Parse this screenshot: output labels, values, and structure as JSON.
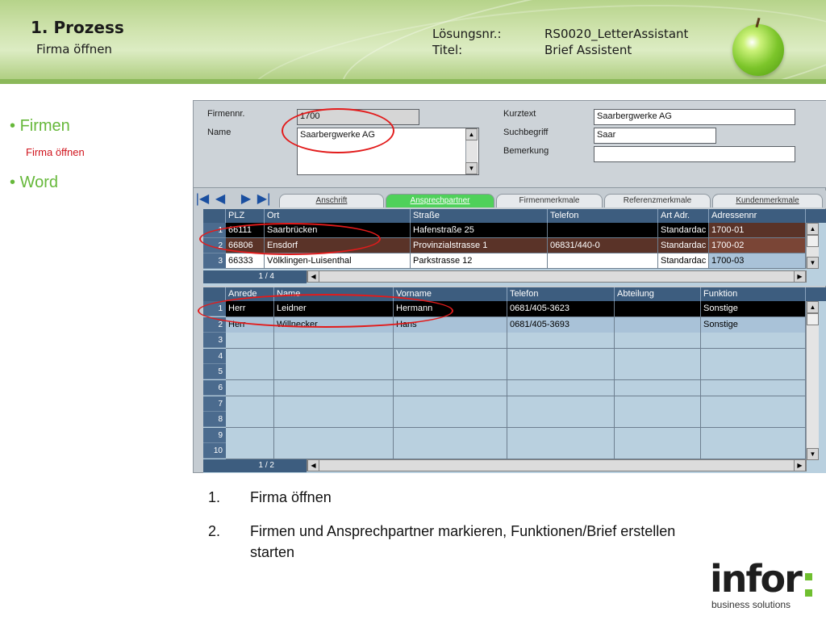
{
  "header": {
    "title": "1. Prozess",
    "subtitle": "Firma öffnen",
    "loesungsnr_label": "Lösungsnr.:",
    "loesungsnr_value": "RS0020_LetterAssistant",
    "titel_label": "Titel:",
    "titel_value": "Brief Assistent"
  },
  "nav": {
    "items": [
      {
        "label": "Firmen",
        "sub": "Firma öffnen"
      },
      {
        "label": "Word"
      }
    ]
  },
  "form": {
    "firmennr_label": "Firmennr.",
    "firmennr_value": "1700",
    "name_label": "Name",
    "name_value": "Saarbergwerke AG",
    "kurztext_label": "Kurztext",
    "kurztext_value": "Saarbergwerke AG",
    "suchbegriff_label": "Suchbegriff",
    "suchbegriff_value": "Saar",
    "bemerkung_label": "Bemerkung",
    "bemerkung_value": ""
  },
  "tabs": [
    {
      "label": "Anschrift",
      "active": false
    },
    {
      "label": "Ansprechpartner",
      "active": true
    },
    {
      "label": "Firmenmerkmale",
      "active": false
    },
    {
      "label": "Referenzmerkmale",
      "active": false
    },
    {
      "label": "Kundenmerkmale",
      "active": false
    }
  ],
  "address_grid": {
    "headers": [
      "PLZ",
      "Ort",
      "Straße",
      "Telefon",
      "Art Adr.",
      "Adressennr"
    ],
    "rows": [
      {
        "num": "1",
        "cells": [
          "66111",
          "Saarbrücken",
          "Hafenstraße 25",
          "",
          "Standardac",
          "1700-01"
        ]
      },
      {
        "num": "2",
        "cells": [
          "66806",
          "Ensdorf",
          "Provinzialstrasse 1",
          "06831/440-0",
          "Standardac",
          "1700-02"
        ]
      },
      {
        "num": "3",
        "cells": [
          "66333",
          "Völklingen-Luisenthal",
          "Parkstrasse 12",
          "",
          "Standardac",
          "1700-03"
        ]
      }
    ],
    "pager": "1 / 4"
  },
  "contact_grid": {
    "headers": [
      "Anrede",
      "Name",
      "Vorname",
      "Telefon",
      "Abteilung",
      "Funktion"
    ],
    "rows": [
      {
        "num": "1",
        "cells": [
          "Herr",
          "Leidner",
          "Hermann",
          "0681/405-3623",
          "",
          "Sonstige"
        ]
      },
      {
        "num": "2",
        "cells": [
          "Herr",
          "Willnecker",
          "Hans",
          "0681/405-3693",
          "",
          "Sonstige"
        ]
      },
      {
        "num": "3",
        "cells": [
          "",
          "",
          "",
          "",
          "",
          ""
        ]
      },
      {
        "num": "4",
        "cells": [
          "",
          "",
          "",
          "",
          "",
          ""
        ]
      },
      {
        "num": "5",
        "cells": [
          "",
          "",
          "",
          "",
          "",
          ""
        ]
      },
      {
        "num": "6",
        "cells": [
          "",
          "",
          "",
          "",
          "",
          ""
        ]
      },
      {
        "num": "7",
        "cells": [
          "",
          "",
          "",
          "",
          "",
          ""
        ]
      },
      {
        "num": "8",
        "cells": [
          "",
          "",
          "",
          "",
          "",
          ""
        ]
      },
      {
        "num": "9",
        "cells": [
          "",
          "",
          "",
          "",
          "",
          ""
        ]
      },
      {
        "num": "10",
        "cells": [
          "",
          "",
          "",
          "",
          "",
          ""
        ]
      }
    ],
    "pager": "1 / 2"
  },
  "steps": [
    {
      "num": "1.",
      "text": "Firma öffnen"
    },
    {
      "num": "2.",
      "text": "Firmen und Ansprechpartner markieren, Funktionen/Brief erstellen",
      "text2": "starten"
    }
  ],
  "logo": {
    "word": "infor",
    "tagline": "business solutions"
  },
  "colors": {
    "accent_green": "#66b83a",
    "nav_sub_red": "#d0141d",
    "grid_header": "#3d5d7f",
    "annotation_red": "#e21b1b"
  }
}
